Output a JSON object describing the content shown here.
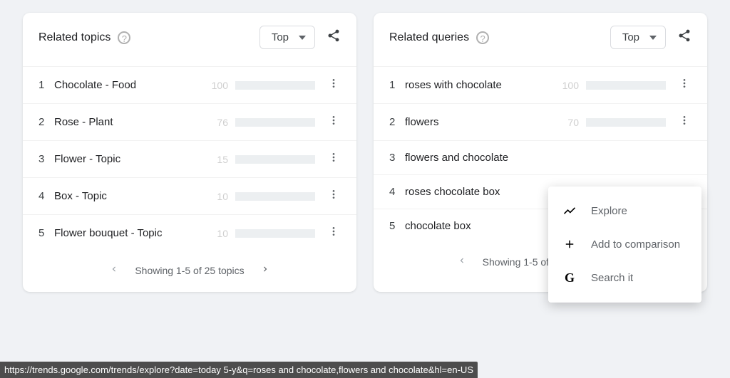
{
  "topics": {
    "title": "Related topics",
    "selector": "Top",
    "rows": [
      {
        "idx": "1",
        "label": "Chocolate - Food",
        "value": "100",
        "pct": 100
      },
      {
        "idx": "2",
        "label": "Rose - Plant",
        "value": "76",
        "pct": 76
      },
      {
        "idx": "3",
        "label": "Flower - Topic",
        "value": "15",
        "pct": 15
      },
      {
        "idx": "4",
        "label": "Box - Topic",
        "value": "10",
        "pct": 10
      },
      {
        "idx": "5",
        "label": "Flower bouquet - Topic",
        "value": "10",
        "pct": 10
      }
    ],
    "pager": "Showing 1-5 of 25 topics"
  },
  "queries": {
    "title": "Related queries",
    "selector": "Top",
    "rows": [
      {
        "idx": "1",
        "label": "roses with chocolate",
        "value": "100",
        "pct": 100,
        "hide_bar": false
      },
      {
        "idx": "2",
        "label": "flowers",
        "value": "70",
        "pct": 70,
        "hide_bar": false
      },
      {
        "idx": "3",
        "label": "flowers and chocolate",
        "value": "",
        "pct": 0,
        "hide_bar": true
      },
      {
        "idx": "4",
        "label": "roses chocolate box",
        "value": "",
        "pct": 0,
        "hide_bar": true
      },
      {
        "idx": "5",
        "label": "chocolate box",
        "value": "",
        "pct": 0,
        "hide_bar": true
      }
    ],
    "pager": "Showing 1-5 of 25 queries"
  },
  "ctx": {
    "explore": "Explore",
    "add": "Add to comparison",
    "search": "Search it"
  },
  "status_url": "https://trends.google.com/trends/explore?date=today 5-y&q=roses and chocolate,flowers and chocolate&hl=en-US"
}
